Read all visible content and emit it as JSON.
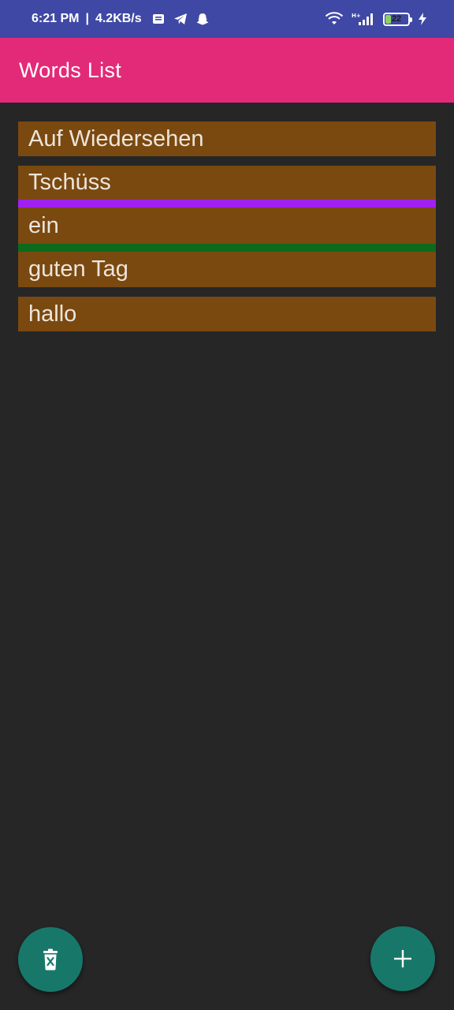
{
  "status_bar": {
    "time": "6:21 PM",
    "separator": "|",
    "network_speed": "4.2KB/s",
    "battery_level": "22",
    "icons": [
      "notes-icon",
      "telegram-icon",
      "snapchat-icon",
      "wifi-icon",
      "signal-icon",
      "battery-icon",
      "charging-icon"
    ]
  },
  "app_bar": {
    "title": "Words List"
  },
  "words": [
    {
      "label": "Auf Wiedersehen"
    },
    {
      "label": "Tschüss"
    },
    {
      "label": "ein"
    },
    {
      "label": "guten Tag"
    },
    {
      "label": "hallo"
    }
  ],
  "colors": {
    "status_bar": "#3f48a5",
    "app_bar": "#e32a78",
    "background": "#262626",
    "word_item": "#7a4910",
    "separator_purple": "#a020f0",
    "separator_green": "#0b6a1b",
    "fab": "#17786a"
  },
  "fabs": {
    "delete_icon": "delete-icon",
    "add_icon": "add-icon"
  }
}
